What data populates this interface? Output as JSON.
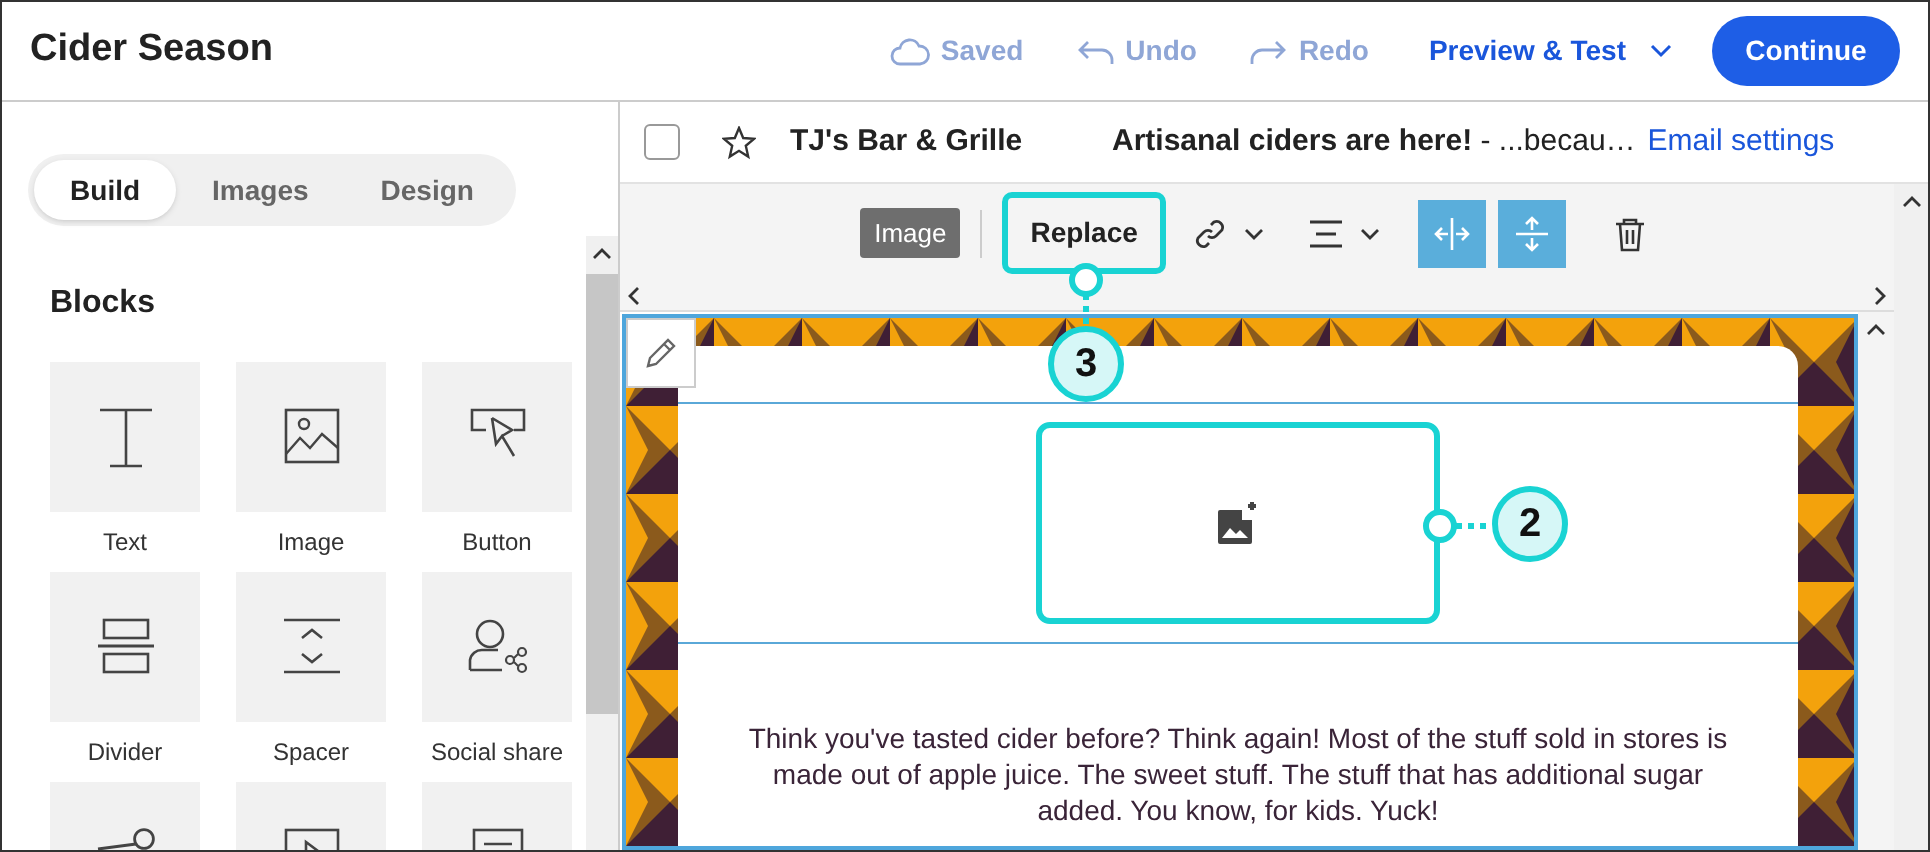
{
  "header": {
    "title": "Cider Season",
    "actions": [
      {
        "kind": "saved",
        "label": "Saved",
        "disabled": true
      },
      {
        "kind": "undo",
        "label": "Undo",
        "disabled": true
      },
      {
        "kind": "redo",
        "label": "Redo",
        "disabled": true
      }
    ],
    "preview": "Preview & Test",
    "primary": "Continue"
  },
  "sidebar": {
    "tabs": [
      {
        "label": "Build",
        "selected": true
      },
      {
        "label": "Images",
        "selected": false
      },
      {
        "label": "Design",
        "selected": false
      }
    ],
    "section": "Blocks",
    "blocks": [
      {
        "kind": "text",
        "label": "Text"
      },
      {
        "kind": "image",
        "label": "Image"
      },
      {
        "kind": "button",
        "label": "Button"
      },
      {
        "kind": "divider",
        "label": "Divider"
      },
      {
        "kind": "spacer",
        "label": "Spacer"
      },
      {
        "kind": "social",
        "label": "Social share"
      },
      {
        "kind": "share"
      },
      {
        "kind": "video"
      },
      {
        "kind": "list"
      }
    ]
  },
  "email": {
    "checked": false,
    "starred": false,
    "sender": "TJ's Bar & Grille",
    "subject": "Artisanal ciders are here!",
    "preview": " - ...becau…",
    "settings_link": "Email settings"
  },
  "toolbar": {
    "badge": "Image",
    "replace": "Replace",
    "toggles": [
      {
        "kind": "horizontal",
        "on": true
      },
      {
        "kind": "vertical",
        "on": true
      }
    ]
  },
  "email_body": {
    "text": "Think you've tasted cider before? Think again! Most of the stuff sold in stores is made out of apple juice. The sweet stuff. The stuff that has additional sugar added. You know, for kids. Yuck!"
  },
  "annotations": [
    {
      "label": "3"
    },
    {
      "label": "2"
    }
  ]
}
